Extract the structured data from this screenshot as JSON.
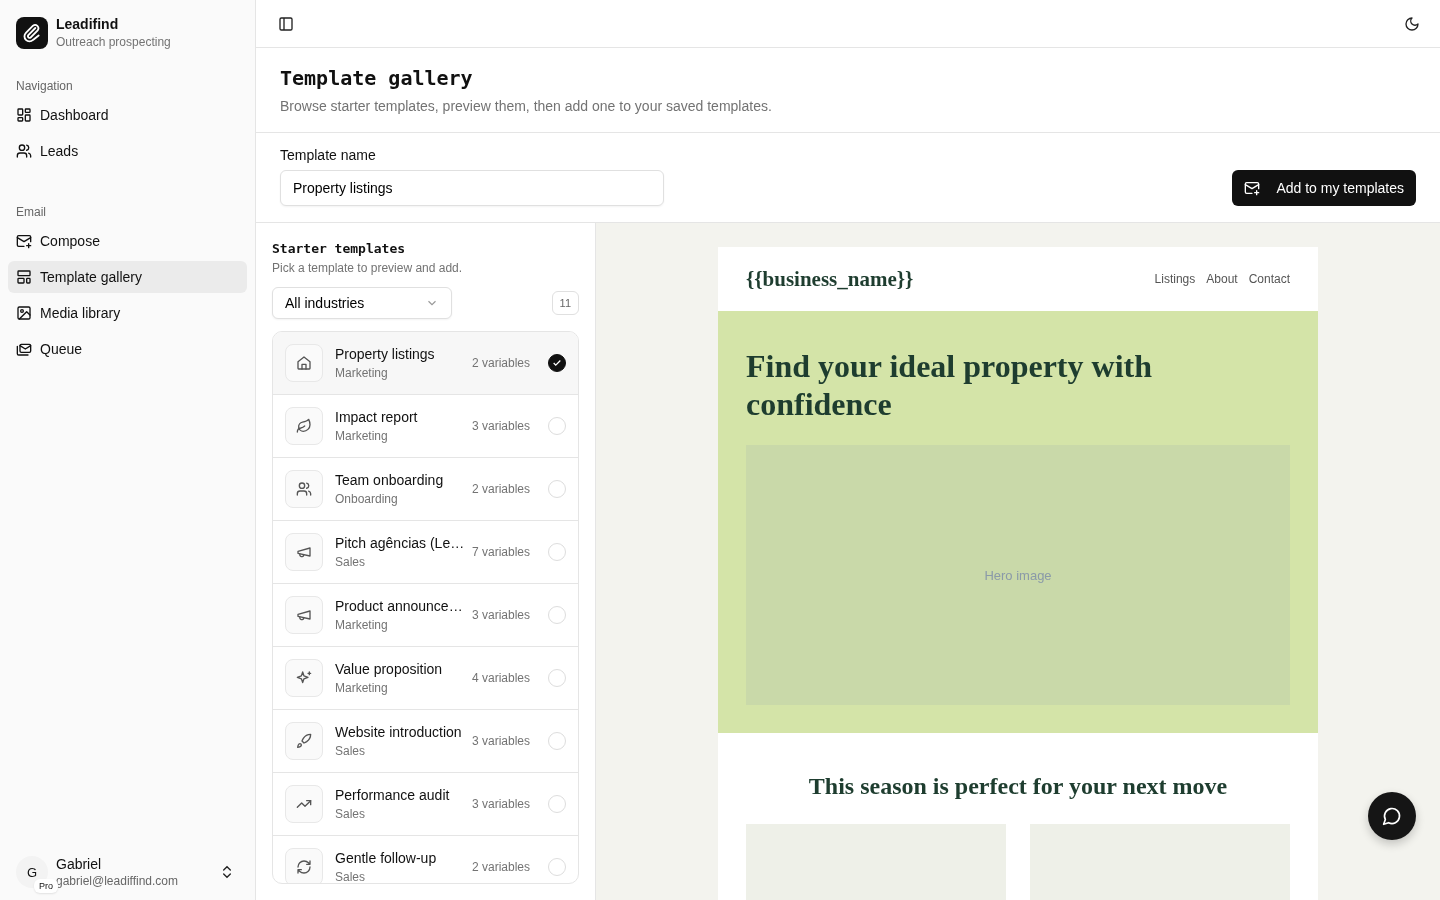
{
  "brand": {
    "name": "Leadifind",
    "tagline": "Outreach prospecting"
  },
  "sidebar": {
    "groups": [
      {
        "label": "Navigation",
        "items": [
          {
            "label": "Dashboard",
            "kind": "dashboard",
            "selected": false
          },
          {
            "label": "Leads",
            "kind": "users",
            "selected": false
          }
        ]
      },
      {
        "label": "Email",
        "items": [
          {
            "label": "Compose",
            "kind": "compose",
            "selected": false
          },
          {
            "label": "Template gallery",
            "kind": "layout",
            "selected": true
          },
          {
            "label": "Media library",
            "kind": "image",
            "selected": false
          },
          {
            "label": "Queue",
            "kind": "queue",
            "selected": false
          }
        ]
      }
    ]
  },
  "user": {
    "initial": "G",
    "plan": "Pro",
    "name": "Gabriel",
    "email": "gabriel@leadiffind.com"
  },
  "page": {
    "title": "Template gallery",
    "subtitle": "Browse starter templates, preview them, then add one to your saved templates."
  },
  "template_name": {
    "label": "Template name",
    "value": "Property listings"
  },
  "add_button": "Add to my templates",
  "starter": {
    "title": "Starter templates",
    "subtitle": "Pick a template to preview and add.",
    "filter": "All industries",
    "count": "11",
    "templates": [
      {
        "name": "Property listings",
        "category": "Marketing",
        "variables": "2 variables",
        "kind": "house",
        "selected": true
      },
      {
        "name": "Impact report",
        "category": "Marketing",
        "variables": "3 variables",
        "kind": "leaf",
        "selected": false
      },
      {
        "name": "Team onboarding",
        "category": "Onboarding",
        "variables": "2 variables",
        "kind": "users",
        "selected": false
      },
      {
        "name": "Pitch agências (Le…",
        "category": "Sales",
        "variables": "7 variables",
        "kind": "megaphone",
        "selected": false
      },
      {
        "name": "Product announce…",
        "category": "Marketing",
        "variables": "3 variables",
        "kind": "megaphone",
        "selected": false
      },
      {
        "name": "Value proposition",
        "category": "Marketing",
        "variables": "4 variables",
        "kind": "sparkles",
        "selected": false
      },
      {
        "name": "Website introduction",
        "category": "Sales",
        "variables": "3 variables",
        "kind": "rocket",
        "selected": false
      },
      {
        "name": "Performance audit",
        "category": "Sales",
        "variables": "3 variables",
        "kind": "trend",
        "selected": false
      },
      {
        "name": "Gentle follow-up",
        "category": "Sales",
        "variables": "2 variables",
        "kind": "refresh",
        "selected": false
      }
    ]
  },
  "preview": {
    "business": "{{business_name}}",
    "links": [
      "Listings",
      "About",
      "Contact"
    ],
    "hero_title": "Find your ideal property with confidence",
    "hero_image": "Hero image",
    "section_title": "This season is perfect for your next move"
  }
}
